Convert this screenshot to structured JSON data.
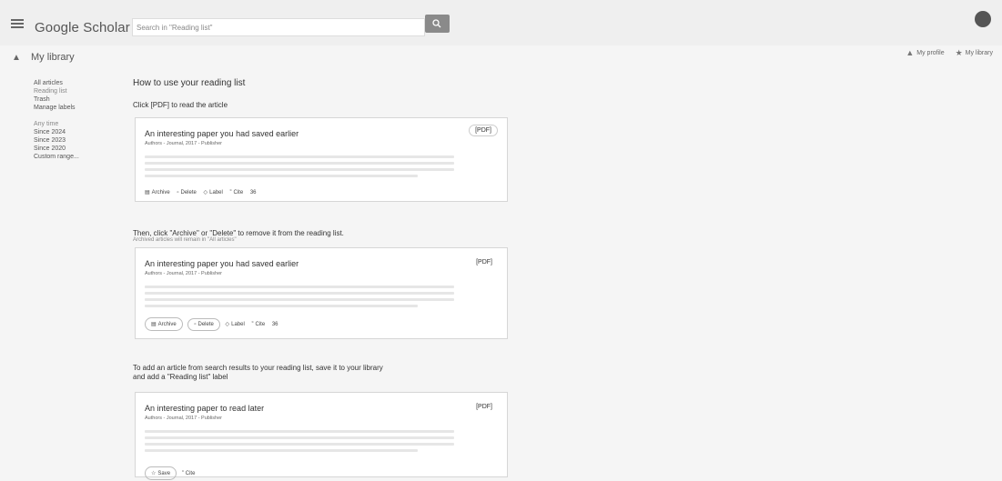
{
  "app": {
    "logo": "Google Scholar"
  },
  "search": {
    "placeholder": "Search in \"Reading list\""
  },
  "top_links": {
    "profile": "My profile",
    "library": "My library"
  },
  "library_header": "My library",
  "sidebar": {
    "items": [
      "All articles",
      "Reading list",
      "Trash",
      "Manage labels"
    ],
    "time_filters": [
      "Any time",
      "Since 2024",
      "Since 2023",
      "Since 2020",
      "Custom range..."
    ]
  },
  "main": {
    "heading": "How to use your reading list",
    "step1": "Click [PDF] to read the article",
    "step2": "Then, click \"Archive\" or \"Delete\" to remove it from the reading list.",
    "step2_note": "Archived articles will remain in \"All articles\"",
    "step3": "To add an article from search results to your reading list, save it to your library and add a \"Reading list\" label"
  },
  "cards": [
    {
      "title": "An interesting paper you had saved earlier",
      "meta": "Authors - Journal, 2017 - Publisher",
      "pdf": "[PDF]",
      "actions": [
        "Archive",
        "Delete",
        "Label",
        "Cite",
        "36"
      ]
    },
    {
      "title": "An interesting paper you had saved earlier",
      "meta": "Authors - Journal, 2017 - Publisher",
      "pdf": "[PDF]",
      "actions": [
        "Archive",
        "Delete",
        "Label",
        "Cite",
        "36"
      ]
    },
    {
      "title": "An interesting paper to read later",
      "meta": "Authors - Journal, 2017 - Publisher",
      "pdf": "[PDF]",
      "actions": [
        "Save",
        "Cite"
      ]
    }
  ],
  "icons": {
    "menu": "hamburger-icon",
    "search": "search-icon",
    "profile": "graduation-cap-icon",
    "library": "star-icon",
    "archive": "archive-icon",
    "delete": "trash-icon",
    "label": "label-icon",
    "cite": "quote-icon",
    "save": "star-icon"
  }
}
